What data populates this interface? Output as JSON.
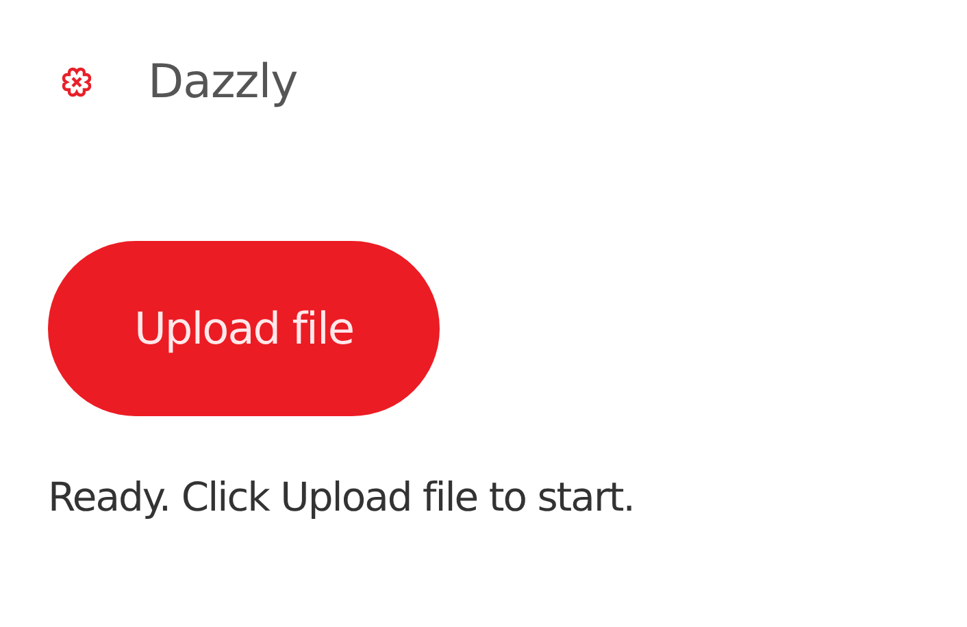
{
  "app": {
    "title": "Dazzly"
  },
  "upload_button": {
    "label": "Upload file"
  },
  "status": {
    "text": "Ready. Click Upload file to start."
  }
}
